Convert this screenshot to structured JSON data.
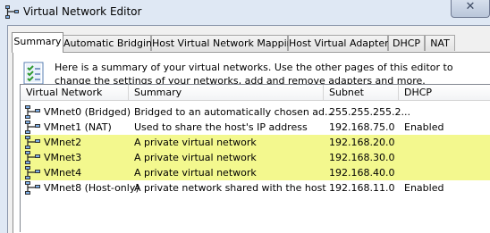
{
  "window": {
    "title": "Virtual Network Editor",
    "close_glyph": "✕"
  },
  "tabs": [
    {
      "label": "Summary",
      "active": true
    },
    {
      "label": "Automatic Bridging",
      "active": false
    },
    {
      "label": "Host Virtual Network Mapping",
      "active": false
    },
    {
      "label": "Host Virtual Adapters",
      "active": false
    },
    {
      "label": "DHCP",
      "active": false
    },
    {
      "label": "NAT",
      "active": false
    }
  ],
  "summary": {
    "info_icon": "checklist-icon",
    "info_text": "Here is a summary of your virtual networks. Use the other pages of this editor to change the settings of your networks, add and remove adapters and more."
  },
  "table": {
    "columns": [
      "Virtual Network",
      "Summary",
      "Subnet",
      "DHCP"
    ],
    "row_icon": "network-adapter-icon",
    "highlight_color": "#f3f88e",
    "rows": [
      {
        "network": "VMnet0 (Bridged)",
        "summary": "Bridged to an automatically chosen ad...",
        "subnet": "255.255.255.2...",
        "dhcp": "",
        "highlighted": false
      },
      {
        "network": "VMnet1 (NAT)",
        "summary": "Used to share the host's IP address",
        "subnet": "192.168.75.0",
        "dhcp": "Enabled",
        "highlighted": false
      },
      {
        "network": "VMnet2",
        "summary": "A private virtual network",
        "subnet": "192.168.20.0",
        "dhcp": "",
        "highlighted": true
      },
      {
        "network": "VMnet3",
        "summary": "A private virtual network",
        "subnet": "192.168.30.0",
        "dhcp": "",
        "highlighted": true
      },
      {
        "network": "VMnet4",
        "summary": "A private virtual network",
        "subnet": "192.168.40.0",
        "dhcp": "",
        "highlighted": true
      },
      {
        "network": "VMnet8 (Host-only)",
        "summary": "A private network shared with the host",
        "subnet": "192.168.11.0",
        "dhcp": "Enabled",
        "highlighted": false
      }
    ]
  }
}
